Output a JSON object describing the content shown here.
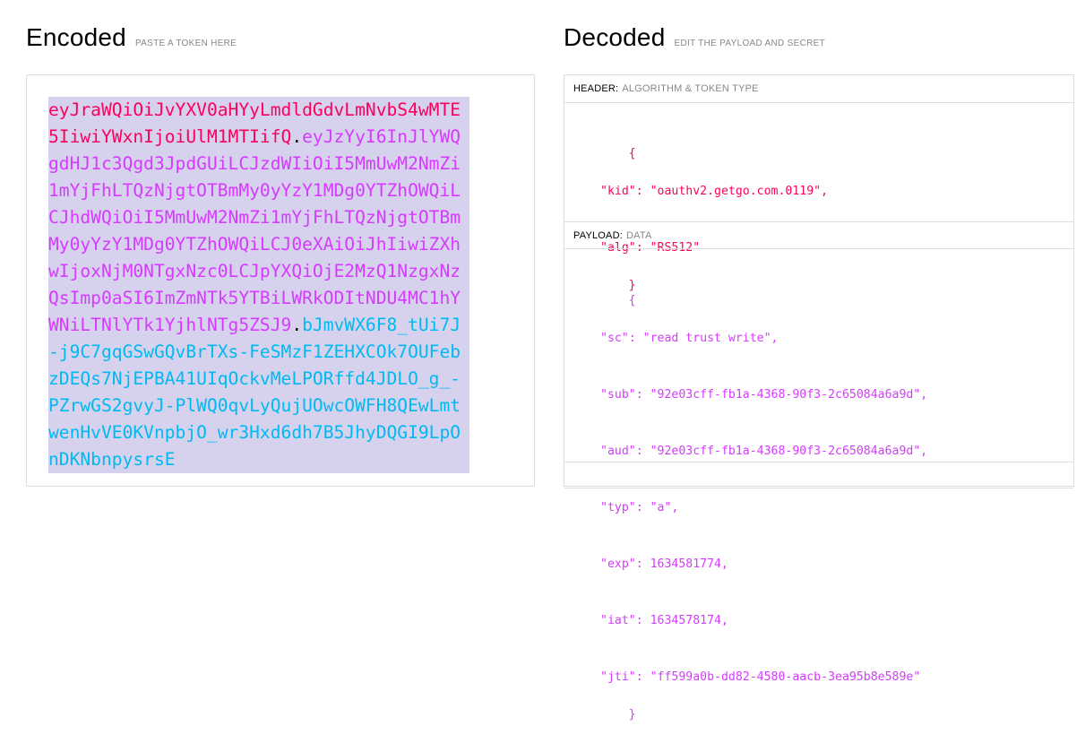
{
  "encoded": {
    "title": "Encoded",
    "subtitle": "PASTE A TOKEN HERE",
    "token_header": "eyJraWQiOiJvYXV0aHYyLmdldGdvLmNvbS4wMTE5IiwiYWxnIjoiUlM1MTIifQ",
    "token_payload": "eyJzYyI6InJlYWQgdHJ1c3Qgd3JpdGUiLCJzdWIiOiI5MmUwM2NmZi1mYjFhLTQzNjgtOTBmMy0yYzY1MDg0YTZhOWQiLCJhdWQiOiI5MmUwM2NmZi1mYjFhLTQzNjgtOTBmMy0yYzY1MDg0YTZhOWQiLCJ0eXAiOiJhIiwiZXhwIjoxNjM0NTgxNzc0LCJpYXQiOjE2MzQ1NzgxNzQsImp0aSI6ImZmNTk5YTBiLWRkODItNDU4MC1hYWNiLTNlYTk1YjhlNTg5ZSJ9",
    "token_signature": "bJmvWX6F8_tUi7J-j9C7gqGSwGQvBrTXs-FeSMzF1ZEHXCOk7OUFebzDEQs7NjEPBA41UIqOckvMeLPORffd4JDLO_g_-PZrwGS2gvyJ-PlWQ0qvLyQujUOwcOWFH8QEwLmtwenHvVE0KVnpbjO_wr3Hxd6dh7B5JhyDQGI9LpOnDKNbnpysrsE",
    "dot": "."
  },
  "decoded": {
    "title": "Decoded",
    "subtitle": "EDIT THE PAYLOAD AND SECRET",
    "header_label": "HEADER:",
    "header_sub": "ALGORITHM & TOKEN TYPE",
    "header_json": {
      "open": "{",
      "lines": [
        "\"kid\": \"oauthv2.getgo.com.0119\",",
        "\"alg\": \"RS512\""
      ],
      "close": "}"
    },
    "payload_label": "PAYLOAD:",
    "payload_sub": "DATA",
    "payload_json": {
      "open": "{",
      "lines": [
        "\"sc\": \"read trust write\",",
        "\"sub\": \"92e03cff-fb1a-4368-90f3-2c65084a6a9d\",",
        "\"aud\": \"92e03cff-fb1a-4368-90f3-2c65084a6a9d\",",
        "\"typ\": \"a\",",
        "\"exp\": 1634581774,",
        "\"iat\": 1634578174,",
        "\"jti\": \"ff599a0b-dd82-4580-aacb-3ea95b8e589e\""
      ],
      "close": "}"
    }
  },
  "colors": {
    "header": "#fb015b",
    "payload": "#d63aff",
    "signature": "#00b9f1",
    "selection": "#d6d2ee"
  }
}
